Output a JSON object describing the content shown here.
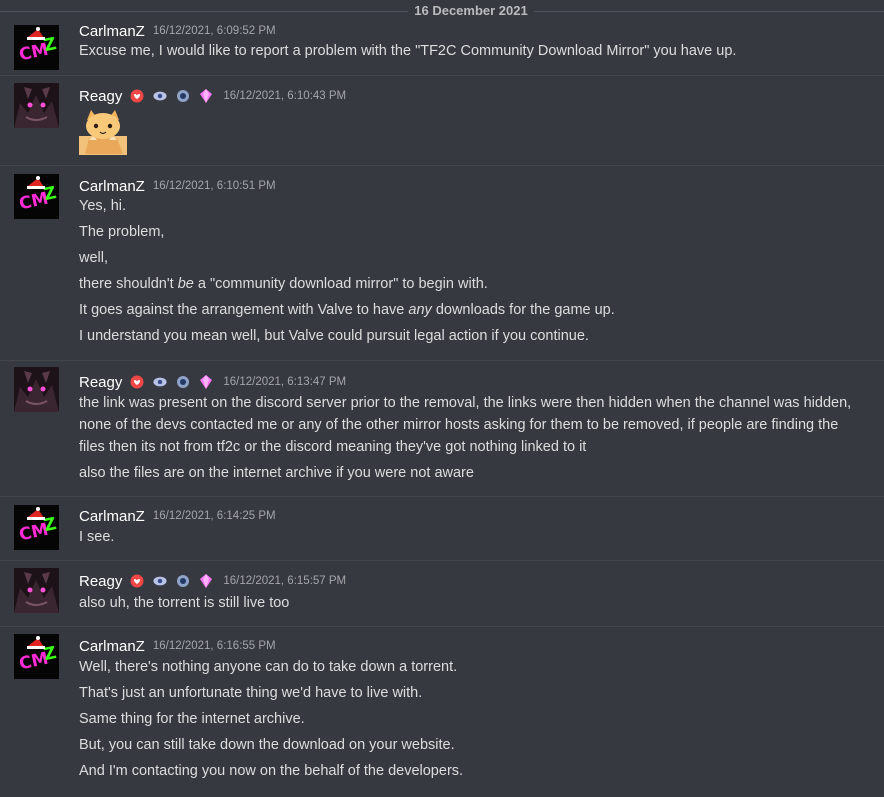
{
  "divider": {
    "date": "16 December 2021"
  },
  "users": {
    "carlman": {
      "name": "CarlmanZ",
      "avatar_text": "CMZ"
    },
    "reagy": {
      "name": "Reagy"
    }
  },
  "messages": [
    {
      "author": "CarlmanZ",
      "timestamp": "16/12/2021, 6:09:52 PM",
      "lines": [
        "Excuse me, I would like to report a problem with the \"TF2C Community Download Mirror\" you have up."
      ]
    },
    {
      "author": "Reagy",
      "timestamp": "16/12/2021, 6:10:43 PM",
      "sticker": "cat-peeking-emoji"
    },
    {
      "author": "CarlmanZ",
      "timestamp": "16/12/2021, 6:10:51 PM",
      "lines": [
        "Yes, hi.",
        "The problem,",
        "well,",
        "there shouldn't ",
        "be",
        " a \"community download mirror\" to begin with.",
        "It goes against the arrangement with Valve to have ",
        "any",
        " downloads for the game up.",
        "I understand you mean well, but Valve could pursuit legal action if you continue."
      ]
    },
    {
      "author": "Reagy",
      "timestamp": "16/12/2021, 6:13:47 PM",
      "lines": [
        "the link was present on the discord server prior to the removal, the links were then hidden when the channel was hidden,",
        "none of the devs contacted me or any of the other mirror hosts asking for them to be removed, if people are finding the",
        "files then its not from tf2c or the discord meaning they've got nothing linked to it",
        "also the files are on the internet archive if you were not aware"
      ]
    },
    {
      "author": "CarlmanZ",
      "timestamp": "16/12/2021, 6:14:25 PM",
      "lines": [
        "I see."
      ]
    },
    {
      "author": "Reagy",
      "timestamp": "16/12/2021, 6:15:57 PM",
      "lines": [
        "also uh, the torrent is still live too"
      ]
    },
    {
      "author": "CarlmanZ",
      "timestamp": "16/12/2021, 6:16:55 PM",
      "lines": [
        "Well, there's nothing anyone can do to take down a torrent.",
        "That's just an unfortunate thing we'd have to live with.",
        "Same thing for the internet archive.",
        "But, you can still take down the download on your website.",
        "And I'm contacting you now on the behalf of the developers."
      ]
    }
  ],
  "colors": {
    "background": "#36393f",
    "text": "#dcddde",
    "username": "#ffffff",
    "timestamp": "#a3a6aa",
    "avatar_accent_magenta": "#ff2bd6",
    "avatar_accent_green": "#39ff14"
  },
  "badge_icons": [
    "heart-badge-icon",
    "eye-badge-icon",
    "orb-badge-icon",
    "gem-badge-icon"
  ]
}
